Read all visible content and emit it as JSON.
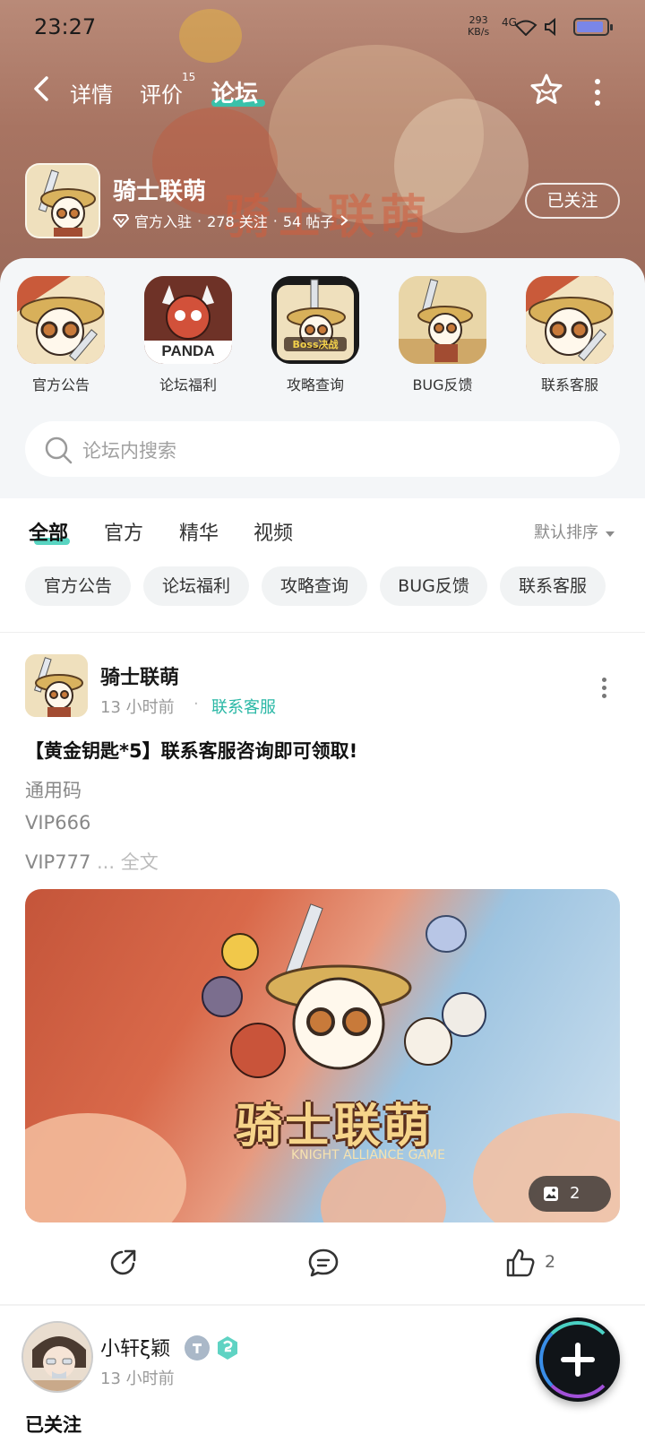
{
  "status_bar": {
    "time": "23:27",
    "net_speed": "293",
    "net_unit": "KB/s",
    "signal": "4G",
    "battery_level": 0.9
  },
  "nav": {
    "tabs": [
      "详情",
      "评价",
      "论坛"
    ],
    "review_count": "15",
    "active_tab": "论坛"
  },
  "forum": {
    "name": "骑士联萌",
    "banner_text": "骑士联萌",
    "official": "官方入驻",
    "followers": "278 关注",
    "posts": "54 帖子",
    "follow_label": "已关注"
  },
  "shortcuts": [
    {
      "label": "官方公告",
      "icon": "announcement-icon"
    },
    {
      "label": "论坛福利",
      "icon": "welfare-icon",
      "overlay": "PANDA"
    },
    {
      "label": "攻略查询",
      "icon": "guide-icon",
      "overlay": "Boss决战"
    },
    {
      "label": "BUG反馈",
      "icon": "bug-report-icon"
    },
    {
      "label": "联系客服",
      "icon": "customer-service-icon"
    }
  ],
  "search": {
    "placeholder": "论坛内搜索"
  },
  "filter_tabs": [
    "全部",
    "官方",
    "精华",
    "视频"
  ],
  "sort_label": "默认排序",
  "chips": [
    "官方公告",
    "论坛福利",
    "攻略查询",
    "BUG反馈",
    "联系客服"
  ],
  "post": {
    "author": "骑士联萌",
    "time": "13 小时前",
    "tag": "联系客服",
    "title": "【黄金钥匙*5】联系客服咨询即可领取!",
    "lines": [
      "通用码",
      "VIP666",
      "VIP777"
    ],
    "more_text": "... 全文",
    "image_title": "骑士联萌",
    "image_subtitle": "KNIGHT ALLIANCE GAME",
    "image_count": "2",
    "like_count": "2"
  },
  "next_post": {
    "author": "小轩ξ颖",
    "time": "13 小时前",
    "follow_text": "已关注"
  },
  "colors": {
    "accent": "#2ec9b1",
    "tag": "#2bb8a6"
  }
}
